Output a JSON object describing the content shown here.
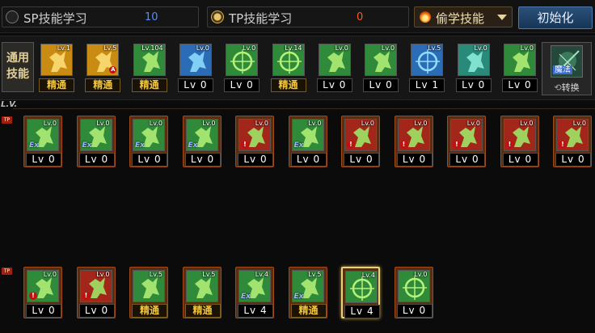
{
  "top": {
    "sp_label": "SP技能学习",
    "sp_value": "10",
    "tp_label": "TP技能学习",
    "tp_value": "0",
    "dropdown_label": "偷学技能",
    "init_button": "初始化"
  },
  "common": {
    "label_line1": "通用",
    "label_line2": "技能",
    "switch_badge": "魔法",
    "switch_label": "转换",
    "skills": [
      {
        "icon": "yellow-figure-icon",
        "lvtag": "Lv.1",
        "level": "精通",
        "mastered": true
      },
      {
        "icon": "yellow-beast-icon",
        "lvtag": "Lv.5",
        "level": "精通",
        "mastered": true,
        "badge": "A"
      },
      {
        "icon": "green-crouch-icon",
        "lvtag": "Lv.104",
        "level": "精通",
        "mastered": true
      },
      {
        "icon": "blue-wings-icon",
        "lvtag": "Lv.0",
        "level": "Lv 0",
        "mastered": false
      },
      {
        "icon": "green-crosshair-icon",
        "lvtag": "Lv.0",
        "level": "Lv 0",
        "mastered": false
      },
      {
        "icon": "green-crosshair-2-icon",
        "lvtag": "Lv.14",
        "level": "精通",
        "mastered": true
      },
      {
        "icon": "green-leap-icon",
        "lvtag": "Lv.0",
        "level": "Lv 0",
        "mastered": false
      },
      {
        "icon": "green-kick-icon",
        "lvtag": "Lv.0",
        "level": "Lv 0",
        "mastered": false
      },
      {
        "icon": "blue-eye-icon",
        "lvtag": "Lv.5",
        "level": "Lv 1",
        "mastered": false
      },
      {
        "icon": "teal-armor-icon",
        "lvtag": "Lv.0",
        "level": "Lv 0",
        "mastered": false
      },
      {
        "icon": "green-slash-icon",
        "lvtag": "Lv.0",
        "level": "Lv 0",
        "mastered": false
      }
    ]
  },
  "section1": {
    "header": "L.V.",
    "tp_mark": "TP",
    "skills": [
      {
        "icon": "green-runner-icon",
        "lvtag": "Lv.0",
        "level": "Lv 0",
        "mark": "Ex"
      },
      {
        "icon": "green-punch-icon",
        "lvtag": "Lv.0",
        "level": "Lv 0",
        "mark": "Ex"
      },
      {
        "icon": "green-swirl-icon",
        "lvtag": "Lv.0",
        "level": "Lv 0",
        "mark": "Ex"
      },
      {
        "icon": "green-speed-icon",
        "lvtag": "Lv.0",
        "level": "Lv 0",
        "mark": "Ex"
      },
      {
        "icon": "red-missile-icon",
        "lvtag": "Lv.0",
        "level": "Lv 0",
        "mark": "!"
      },
      {
        "icon": "green-burst-icon",
        "lvtag": "Lv.0",
        "level": "Lv 0",
        "mark": "Ex"
      },
      {
        "icon": "red-cross-icon",
        "lvtag": "Lv.0",
        "level": "Lv 0",
        "mark": "!"
      },
      {
        "icon": "red-dive-icon",
        "lvtag": "Lv.0",
        "level": "Lv 0",
        "mark": "!"
      },
      {
        "icon": "red-claw-icon",
        "lvtag": "Lv.0",
        "level": "Lv 0",
        "mark": "!"
      },
      {
        "icon": "red-beast-icon",
        "lvtag": "Lv.0",
        "level": "Lv 0",
        "mark": "!"
      },
      {
        "icon": "red-grenade-icon",
        "lvtag": "Lv.0",
        "level": "Lv 0",
        "mark": "!"
      }
    ]
  },
  "section2": {
    "tp_mark": "TP",
    "skills": [
      {
        "icon": "green-bomb-icon",
        "lvtag": "Lv.0",
        "level": "Lv 0",
        "mark": "!",
        "mastered": false
      },
      {
        "icon": "red-cannon-icon",
        "lvtag": "Lv.0",
        "level": "Lv 0",
        "mark": "!",
        "mastered": false
      },
      {
        "icon": "green-brute-icon",
        "lvtag": "Lv.5",
        "level": "精通",
        "mark": "",
        "mastered": true
      },
      {
        "icon": "green-gear-body-icon",
        "lvtag": "Lv.5",
        "level": "精通",
        "mark": "",
        "mastered": true
      },
      {
        "icon": "green-blade-icon",
        "lvtag": "Lv.4",
        "level": "Lv 4",
        "mark": "Ex",
        "mastered": false
      },
      {
        "icon": "green-gun-icon",
        "lvtag": "Lv.5",
        "level": "精通",
        "mark": "Ex",
        "mastered": true
      },
      {
        "icon": "green-target-icon",
        "lvtag": "Lv.4",
        "level": "Lv 4",
        "mark": "",
        "mastered": false,
        "selected": true
      },
      {
        "icon": "green-cog-icon",
        "lvtag": "Lv.0",
        "level": "Lv 0",
        "mark": "",
        "mastered": false
      }
    ]
  },
  "colors": {
    "green": "#2f8a3a",
    "yellow": "#c98b12",
    "red": "#a3261a",
    "blue": "#2c6bb5",
    "teal": "#2a8a7a"
  }
}
